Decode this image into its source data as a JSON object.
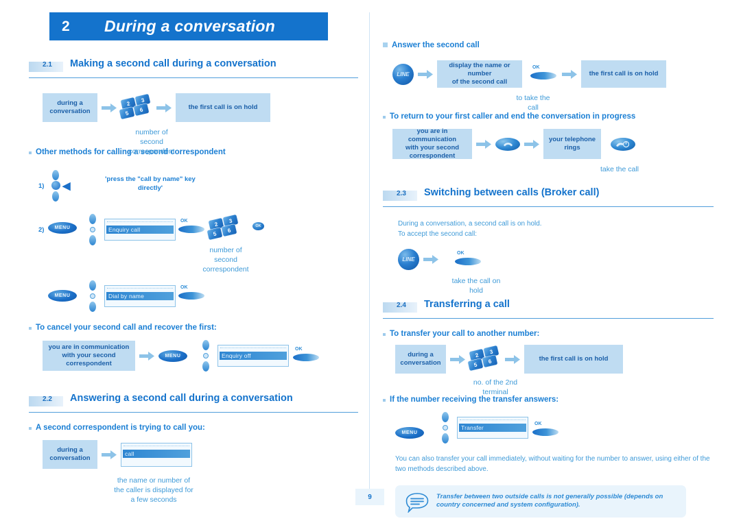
{
  "header": {
    "chapter_number": "2",
    "chapter_title": "During a conversation"
  },
  "page_number": "9",
  "sections": {
    "s21": {
      "num": "2.1",
      "title": "Making a second call during a conversation"
    },
    "s22": {
      "num": "2.2",
      "title": "Answering a second call during a conversation"
    },
    "s23": {
      "num": "2.3",
      "title": "Switching between calls (Broker call)"
    },
    "s24": {
      "num": "2.4",
      "title": "Transferring a call"
    }
  },
  "labels": {
    "during_a_conversation": "during a\nconversation",
    "first_call_on_hold": "the first call is on hold",
    "number_of_second_correspondent": "number of\nsecond\ncorrespondent",
    "other_methods": "Other methods for calling a second correspondent",
    "step1_num": "1)",
    "step2_num": "2)",
    "press_call_by_name": "'press the \"call by name\" key\ndirectly'",
    "to_cancel_second": "To cancel your second call and recover the first:",
    "in_communication_second": "you are in communication\nwith your second\ncorrespondent",
    "second_correspondent_calling": "A second correspondent is trying to call you:",
    "name_or_number_caller": "the name or number of\nthe caller is displayed for\na few seconds",
    "answer_second_call": "Answer the second call",
    "display_name_number_second": "display the name or number\nof the second call",
    "to_take_the_call": "to take the\ncall",
    "return_to_first_caller": "To return to your first caller and end the conversation in progress",
    "your_telephone_rings": "your telephone\nrings",
    "take_the_call": "take the call",
    "broker_intro_line1": "During a conversation, a second call is on hold.",
    "broker_intro_line2": "To accept the second call:",
    "take_call_on_hold": "take the call on\nhold",
    "transfer_to_another": "To transfer your call to another number:",
    "no_of_2nd_terminal": "no. of the 2nd\nterminal",
    "if_number_answers": "If the number receiving the transfer answers:",
    "transfer_immediately": "You can also transfer your call immediately, without waiting for the number to answer, using either of the two methods described above.",
    "note_text": "Transfer between two outside calls is not generally possible (depends on country concerned and system configuration)."
  },
  "buttons": {
    "menu": "MENU",
    "line": "LINE",
    "ok": "OK"
  },
  "lcd": {
    "enquiry_call": "Enquiry call",
    "dial_by_name": "Dial by name",
    "enquiry_off": "Enquiry off",
    "incoming_call": "call",
    "transfer": "Transfer"
  },
  "keypad": {
    "k1": "2",
    "k2": "3",
    "k3": "5",
    "k4": "6"
  },
  "colors": {
    "brand_blue": "#1473cc",
    "box_fill": "#bfdcf2",
    "note_fill": "#e9f4fc",
    "text_blue": "#3e9ad8"
  }
}
